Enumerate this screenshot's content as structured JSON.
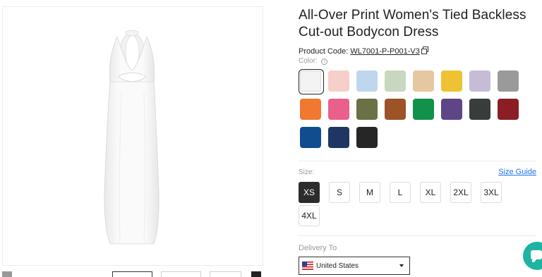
{
  "product": {
    "title": "All-Over Print Women's Tied Backless Cut-out Bodycon Dress",
    "code_label": "Product Code:",
    "code_value": "WL7001-P-P001-V3",
    "color_label": "Color:",
    "info_icon": "i",
    "image_icon": "dress-image"
  },
  "colors": {
    "swatches": [
      "#f3f3f3",
      "#f5cfc8",
      "#bfd7ee",
      "#c8d8c0",
      "#e5c7a1",
      "#efc233",
      "#c6bcd8",
      "#9a9a9a",
      "#f07830",
      "#e9608a",
      "#6b7045",
      "#9c5326",
      "#12914b",
      "#5e4588",
      "#383c3b",
      "#8b1d25",
      "#0f4d8f",
      "#1f3664",
      "#262626"
    ],
    "selected_index": 0
  },
  "size": {
    "label": "Size:",
    "guide": "Size Guide",
    "options": [
      "XS",
      "S",
      "M",
      "L",
      "XL",
      "2XL",
      "3XL",
      "4XL"
    ],
    "selected": "XS"
  },
  "delivery": {
    "label": "Delivery To",
    "country": "United States"
  },
  "chat": {
    "icon": "chat-icon"
  }
}
